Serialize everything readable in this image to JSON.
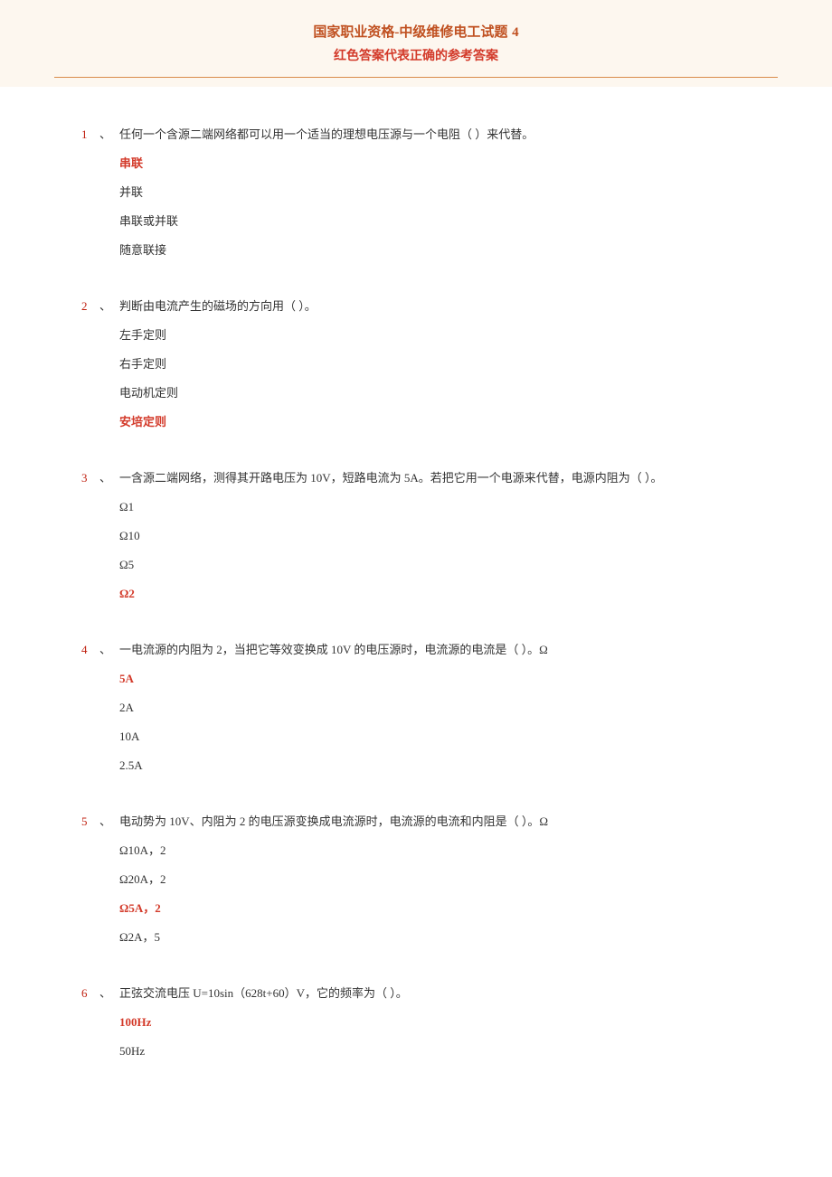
{
  "header": {
    "title": "国家职业资格-中级维修电工试题 4",
    "subtitle": "红色答案代表正确的参考答案"
  },
  "questions": [
    {
      "num": "1",
      "sep": "、",
      "text": "任何一个含源二端网络都可以用一个适当的理想电压源与一个电阻（ ）来代替。",
      "options": [
        {
          "text": "串联",
          "correct": true
        },
        {
          "text": "并联",
          "correct": false
        },
        {
          "text": "串联或并联",
          "correct": false
        },
        {
          "text": "随意联接",
          "correct": false
        }
      ]
    },
    {
      "num": "2",
      "sep": "、",
      "text": "判断由电流产生的磁场的方向用（ ）。",
      "options": [
        {
          "text": "左手定则",
          "correct": false
        },
        {
          "text": "右手定则",
          "correct": false
        },
        {
          "text": "电动机定则",
          "correct": false
        },
        {
          "text": "安培定则",
          "correct": true
        }
      ]
    },
    {
      "num": "3",
      "sep": "、",
      "text": "一含源二端网络，测得其开路电压为 10V，短路电流为 5A。若把它用一个电源来代替，电源内阻为（ ）。",
      "options": [
        {
          "text": "Ω1",
          "correct": false
        },
        {
          "text": "Ω10",
          "correct": false
        },
        {
          "text": "Ω5",
          "correct": false
        },
        {
          "text": "Ω2",
          "correct": true
        }
      ]
    },
    {
      "num": "4",
      "sep": "、",
      "text": "一电流源的内阻为 2，当把它等效变换成 10V 的电压源时，电流源的电流是（ ）。Ω",
      "options": [
        {
          "text": "5A",
          "correct": true
        },
        {
          "text": "2A",
          "correct": false
        },
        {
          "text": "10A",
          "correct": false
        },
        {
          "text": "2.5A",
          "correct": false
        }
      ]
    },
    {
      "num": "5",
      "sep": "、",
      "text": "电动势为 10V、内阻为 2 的电压源变换成电流源时，电流源的电流和内阻是（ ）。Ω",
      "options": [
        {
          "text": "Ω10A，2",
          "correct": false
        },
        {
          "text": "Ω20A，2",
          "correct": false
        },
        {
          "text": "Ω5A，2",
          "correct": true
        },
        {
          "text": "Ω2A，5",
          "correct": false
        }
      ]
    },
    {
      "num": "6",
      "sep": "、",
      "text": "正弦交流电压 U=10sin（628t+60）V，它的频率为（ ）。",
      "options": [
        {
          "text": "100Hz",
          "correct": true
        },
        {
          "text": "50Hz",
          "correct": false
        }
      ]
    }
  ]
}
